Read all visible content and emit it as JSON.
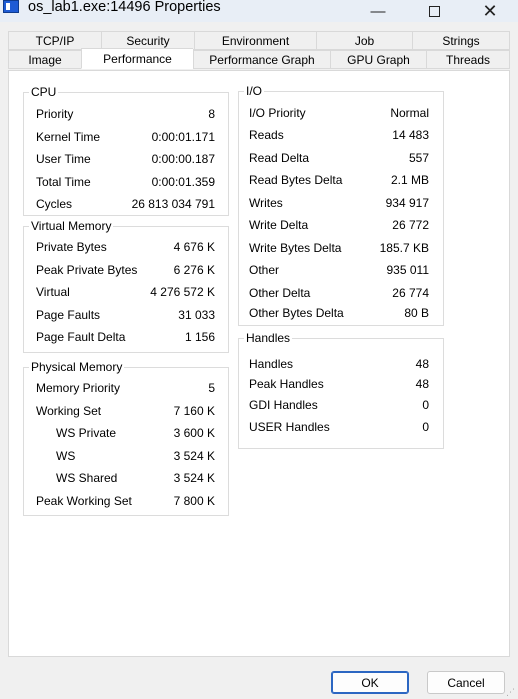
{
  "window": {
    "title": "os_lab1.exe:14496 Properties",
    "minimize": "—",
    "close": "✕"
  },
  "tabs": {
    "back_row": [
      "TCP/IP",
      "Security",
      "Environment",
      "Job",
      "Strings"
    ],
    "front_row": [
      "Image",
      "Performance",
      "Performance Graph",
      "GPU Graph",
      "Threads"
    ],
    "active": "Performance"
  },
  "cpu": {
    "title": "CPU",
    "rows": [
      {
        "label": "Priority",
        "value": "8"
      },
      {
        "label": "Kernel Time",
        "value": "0:00:01.171"
      },
      {
        "label": "User Time",
        "value": "0:00:00.187"
      },
      {
        "label": "Total Time",
        "value": "0:00:01.359"
      },
      {
        "label": "Cycles",
        "value": "26 813 034 791"
      }
    ]
  },
  "virtual_memory": {
    "title": "Virtual Memory",
    "rows": [
      {
        "label": "Private Bytes",
        "value": "4 676 K"
      },
      {
        "label": "Peak Private Bytes",
        "value": "6 276 K"
      },
      {
        "label": "Virtual",
        "value": "4 276 572 K"
      },
      {
        "label": "Page Faults",
        "value": "31 033"
      },
      {
        "label": "Page Fault Delta",
        "value": "1 156"
      }
    ]
  },
  "physical_memory": {
    "title": "Physical Memory",
    "rows": [
      {
        "label": "Memory Priority",
        "value": "5"
      },
      {
        "label": "Working Set",
        "value": "7 160 K"
      },
      {
        "label": "WS Private",
        "value": "3 600 K"
      },
      {
        "label": "WS",
        "value": "3 524 K"
      },
      {
        "label": "WS Shared",
        "value": "3 524 K"
      },
      {
        "label": "Peak Working Set",
        "value": "7 800 K"
      }
    ]
  },
  "io": {
    "title": "I/O",
    "rows": [
      {
        "label": "I/O Priority",
        "value": "Normal"
      },
      {
        "label": "Reads",
        "value": "14 483"
      },
      {
        "label": "Read Delta",
        "value": "557"
      },
      {
        "label": "Read Bytes Delta",
        "value": "2.1  MB"
      },
      {
        "label": "Writes",
        "value": "934 917"
      },
      {
        "label": "Write Delta",
        "value": "26 772"
      },
      {
        "label": "Write Bytes Delta",
        "value": "185.7  KB"
      },
      {
        "label": "Other",
        "value": "935 011"
      },
      {
        "label": "Other Delta",
        "value": "26 774"
      },
      {
        "label": "Other Bytes Delta",
        "value": "80 B"
      }
    ]
  },
  "handles": {
    "title": "Handles",
    "rows": [
      {
        "label": "Handles",
        "value": "48"
      },
      {
        "label": "Peak Handles",
        "value": "48"
      },
      {
        "label": "GDI Handles",
        "value": "0"
      },
      {
        "label": "USER Handles",
        "value": "0"
      }
    ]
  },
  "buttons": {
    "ok": "OK",
    "cancel": "Cancel"
  }
}
